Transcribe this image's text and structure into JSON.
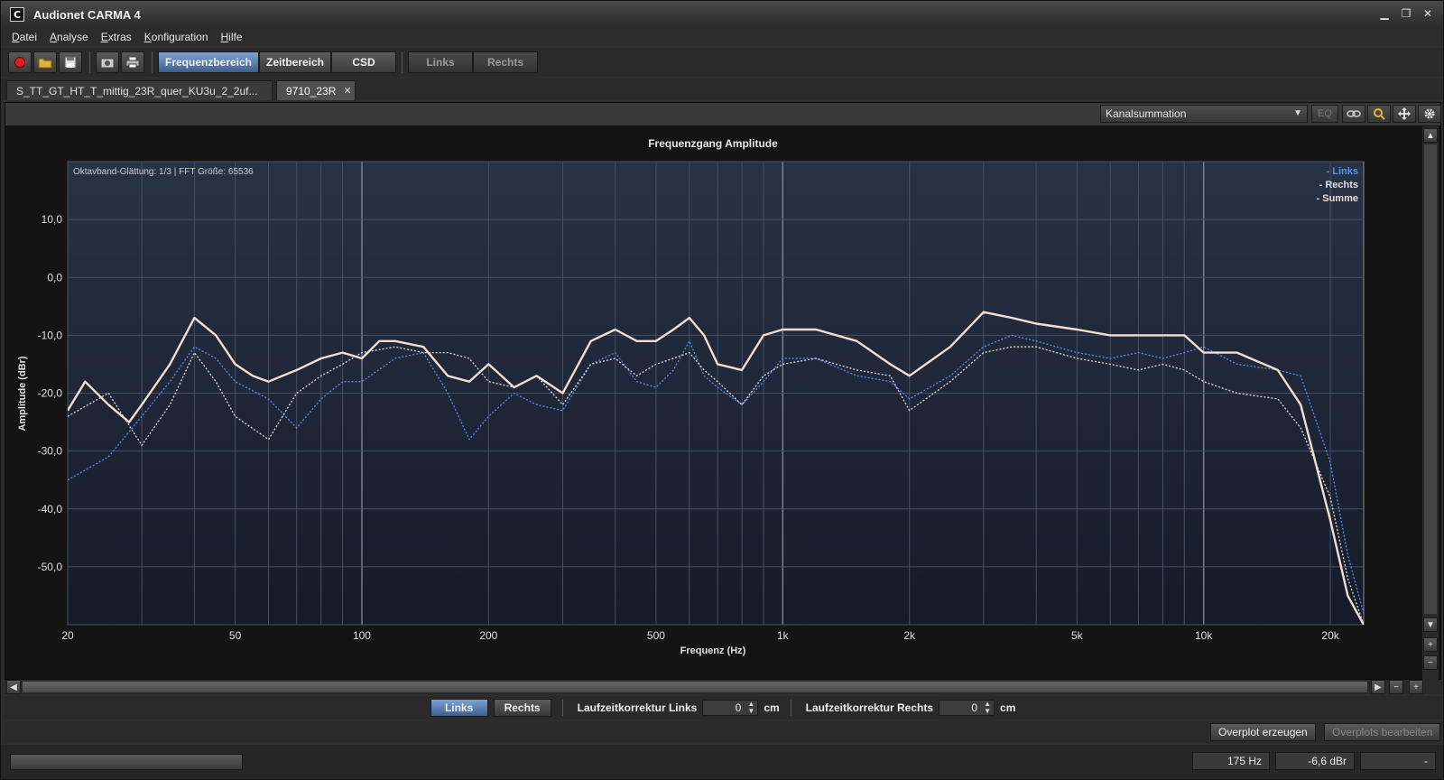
{
  "window": {
    "title": "Audionet CARMA 4",
    "icon_letter": "C"
  },
  "menu": [
    {
      "label": "Datei",
      "accel": "D",
      "rest": "atei"
    },
    {
      "label": "Analyse",
      "accel": "A",
      "rest": "nalyse"
    },
    {
      "label": "Extras",
      "accel": "E",
      "rest": "xtras"
    },
    {
      "label": "Konfiguration",
      "accel": "K",
      "rest": "onfiguration"
    },
    {
      "label": "Hilfe",
      "accel": "H",
      "rest": "ilfe"
    }
  ],
  "toolbar": {
    "view_tabs": [
      "Frequenzbereich",
      "Zeitbereich",
      "CSD"
    ],
    "active_view": "Frequenzbereich",
    "channel_tabs": [
      "Links",
      "Rechts"
    ]
  },
  "doc_tabs": [
    {
      "label": "S_TT_GT_HT_T_mittig_23R_quer_KU3u_2_2uf..."
    },
    {
      "label": "9710_23R",
      "close": "✕"
    }
  ],
  "panel": {
    "mode_select": "Kanalsummation",
    "eq_label": "EQ"
  },
  "chart_data": {
    "type": "line",
    "title": "Frequenzgang Amplitude",
    "info": "Oktavband-Glättung: 1/3 | FFT Größe: 65536",
    "xlabel": "Frequenz (Hz)",
    "ylabel": "Amplitude (dBr)",
    "xscale": "log",
    "xlim": [
      20,
      24000
    ],
    "ylim": [
      -60,
      20
    ],
    "x_ticks": [
      20,
      50,
      100,
      200,
      500,
      1000,
      2000,
      5000,
      10000,
      20000
    ],
    "x_tick_labels": [
      "20",
      "50",
      "100",
      "200",
      "500",
      "1k",
      "2k",
      "5k",
      "10k",
      "20k"
    ],
    "y_ticks": [
      10,
      0,
      -10,
      -20,
      -30,
      -40,
      -50
    ],
    "y_tick_labels": [
      "10,0",
      "0,0",
      "-10,0",
      "-20,0",
      "-30,0",
      "-40,0",
      "-50,0"
    ],
    "grid": true,
    "legend_position": "top-right",
    "series": [
      {
        "name": "- Links",
        "color": "#5b8fe8",
        "style": "dotted",
        "x": [
          20,
          25,
          30,
          35,
          40,
          45,
          50,
          60,
          70,
          80,
          90,
          100,
          120,
          140,
          160,
          180,
          200,
          230,
          260,
          300,
          350,
          400,
          450,
          500,
          550,
          600,
          650,
          700,
          800,
          900,
          1000,
          1200,
          1500,
          1800,
          2000,
          2500,
          3000,
          3500,
          4000,
          5000,
          6000,
          7000,
          8000,
          9000,
          10000,
          12000,
          15000,
          17000,
          20000,
          22000,
          24000
        ],
        "y": [
          -35,
          -31,
          -24,
          -18,
          -12,
          -14,
          -18,
          -21,
          -26,
          -21,
          -18,
          -18,
          -14,
          -13,
          -20,
          -28,
          -24,
          -20,
          -22,
          -23,
          -15,
          -13,
          -18,
          -19,
          -16,
          -11,
          -17,
          -19,
          -22,
          -18,
          -14,
          -14,
          -17,
          -18,
          -21,
          -17,
          -12,
          -10,
          -11,
          -13,
          -14,
          -13,
          -14,
          -13,
          -12,
          -15,
          -16,
          -17,
          -32,
          -48,
          -58
        ]
      },
      {
        "name": "- Rechts",
        "color": "#e0e0e0",
        "style": "dotted",
        "x": [
          20,
          25,
          30,
          35,
          40,
          45,
          50,
          60,
          70,
          80,
          90,
          100,
          120,
          140,
          160,
          180,
          200,
          230,
          260,
          300,
          350,
          400,
          450,
          500,
          550,
          600,
          650,
          700,
          800,
          900,
          1000,
          1200,
          1500,
          1800,
          2000,
          2500,
          3000,
          3500,
          4000,
          5000,
          6000,
          7000,
          8000,
          9000,
          10000,
          12000,
          15000,
          17000,
          20000,
          22000,
          24000
        ],
        "y": [
          -24,
          -20,
          -29,
          -22,
          -13,
          -18,
          -24,
          -28,
          -20,
          -17,
          -15,
          -13,
          -12,
          -13,
          -13,
          -14,
          -18,
          -19,
          -17,
          -22,
          -15,
          -14,
          -17,
          -15,
          -14,
          -13,
          -16,
          -18,
          -22,
          -17,
          -15,
          -14,
          -16,
          -17,
          -23,
          -18,
          -13,
          -12,
          -12,
          -14,
          -15,
          -16,
          -15,
          -16,
          -18,
          -20,
          -21,
          -26,
          -38,
          -52,
          -60
        ]
      },
      {
        "name": "- Summe",
        "color": "#f0ded2",
        "style": "solid",
        "x": [
          20,
          22,
          25,
          28,
          30,
          35,
          40,
          45,
          50,
          55,
          60,
          70,
          80,
          90,
          100,
          110,
          120,
          140,
          160,
          180,
          200,
          230,
          260,
          300,
          350,
          400,
          450,
          500,
          550,
          600,
          650,
          700,
          800,
          900,
          1000,
          1200,
          1500,
          1800,
          2000,
          2500,
          3000,
          3500,
          4000,
          5000,
          6000,
          7000,
          8000,
          9000,
          10000,
          12000,
          15000,
          17000,
          20000,
          22000,
          24000
        ],
        "y": [
          -23,
          -18,
          -22,
          -25,
          -22,
          -15,
          -7,
          -10,
          -15,
          -17,
          -18,
          -16,
          -14,
          -13,
          -14,
          -11,
          -11,
          -12,
          -17,
          -18,
          -15,
          -19,
          -17,
          -20,
          -11,
          -9,
          -11,
          -11,
          -9,
          -7,
          -10,
          -15,
          -16,
          -10,
          -9,
          -9,
          -11,
          -15,
          -17,
          -12,
          -6,
          -7,
          -8,
          -9,
          -10,
          -10,
          -10,
          -10,
          -13,
          -13,
          -16,
          -22,
          -42,
          -55,
          -60
        ]
      }
    ]
  },
  "bottom": {
    "links": "Links",
    "rechts": "Rechts",
    "delay_left_label": "Laufzeitkorrektur Links",
    "delay_left_value": "0",
    "delay_right_label": "Laufzeitkorrektur Rechts",
    "delay_right_value": "0",
    "unit": "cm"
  },
  "overplot": {
    "create": "Overplot erzeugen",
    "edit": "Overplots bearbeiten"
  },
  "status": {
    "freq": "175 Hz",
    "level": "-6,6 dBr",
    "extra": "-"
  }
}
